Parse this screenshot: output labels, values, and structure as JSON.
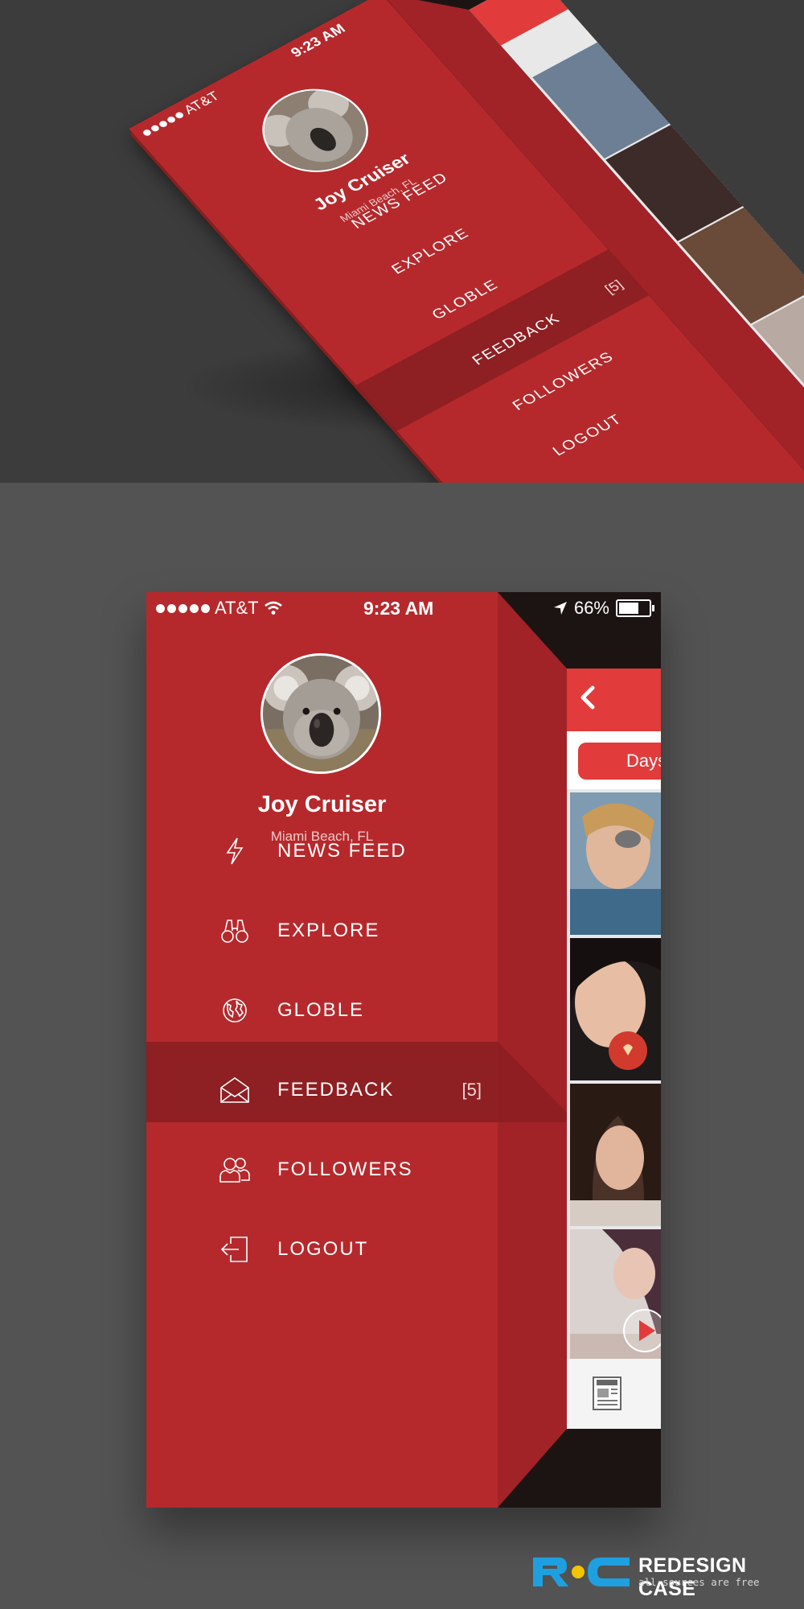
{
  "status_bar": {
    "carrier": "AT&T",
    "time": "9:23 AM",
    "battery": "66%",
    "battery_level": 0.66
  },
  "profile": {
    "name": "Joy Cruiser",
    "location": "Miami Beach, FL"
  },
  "menu": {
    "items": [
      {
        "label": "NEWS FEED",
        "icon": "lightning-icon",
        "badge": ""
      },
      {
        "label": "EXPLORE",
        "icon": "binoculars-icon",
        "badge": ""
      },
      {
        "label": "GLOBLE",
        "icon": "globe-icon",
        "badge": ""
      },
      {
        "label": "FEEDBACK",
        "icon": "envelope-icon",
        "badge": "[5]"
      },
      {
        "label": "FOLLOWERS",
        "icon": "followers-icon",
        "badge": ""
      },
      {
        "label": "LOGOUT",
        "icon": "logout-icon",
        "badge": ""
      }
    ],
    "active_index": 2
  },
  "peek_app": {
    "filter_label": "Days",
    "back_icon": "chevron-left-icon",
    "tab_icon": "news-icon"
  },
  "brand": {
    "title": "REDESIGN CASE",
    "subtitle": "all sources are free"
  },
  "colors": {
    "menu_red": "#b5292c",
    "active_row": "#8e1f22",
    "accent_red": "#e13b3b",
    "brand_blue": "#1ea0e0",
    "brand_yellow": "#f5c400"
  }
}
